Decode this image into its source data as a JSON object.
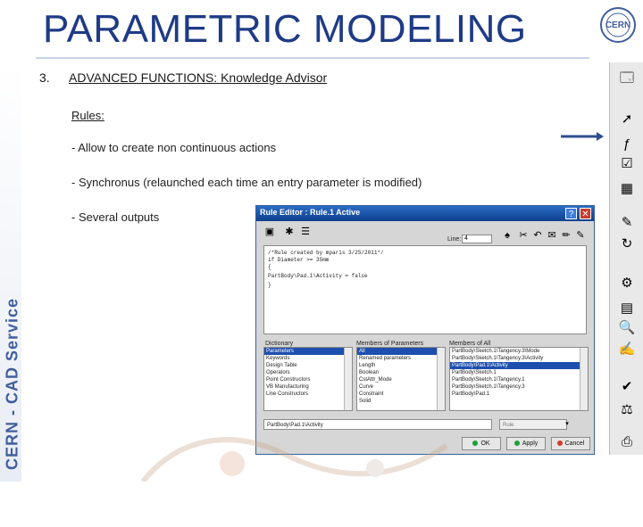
{
  "slide": {
    "title": "PARAMETRIC MODELING",
    "side_label": "CERN - CAD Service",
    "logo_text": "CERN",
    "section_number": "3.",
    "section_title": "ADVANCED FUNCTIONS: Knowledge Advisor",
    "rules_heading": "Rules:",
    "bullets": [
      "- Allow to create non continuous actions",
      "- Synchronus (relaunched each time an entry parameter is modified)",
      "- Several outputs"
    ]
  },
  "dialog": {
    "title": "Rule Editor : Rule.1 Active",
    "help_label": "?",
    "close_label": "✕",
    "line_label": "Line:",
    "line_value": "4",
    "code_lines": [
      "/*Rule created by mparis 3/25/2011*/",
      "if Diameter >= 35mm",
      "{",
      "          PartBody\\Pad.1\\Activity = false",
      "}"
    ],
    "dictionary_header": "Dictionary",
    "dictionary_items": [
      "Parameters",
      "Keywords",
      "Design Table",
      "Operators",
      "Point Constructors",
      "VB Manufacturing",
      "Line Constructors"
    ],
    "members_header": "Members of Parameters",
    "members_items": [
      "All",
      "Renamed parameters",
      "Length",
      "Boolean",
      "CstAttr_Mode",
      "Curve",
      "Constraint",
      "Solid"
    ],
    "all_header": "Members of All",
    "all_items": [
      "PartBody\\Sketch.1\\Tangency.3\\Mode",
      "PartBody\\Sketch.1\\Tangency.3\\Activity",
      "PartBody\\Pad.1\\Activity",
      "PartBody\\Sketch.1",
      "PartBody\\Sketch.1\\Tangency.1",
      "PartBody\\Sketch.1\\Tangency.3",
      "PartBody\\Pad.1"
    ],
    "path_value": "PartBody\\Pad.1\\Activity",
    "combo_value": "Rule",
    "ok_label": "OK",
    "apply_label": "Apply",
    "cancel_label": "Cancel"
  },
  "colors": {
    "title": "#1f3b86",
    "dialog_titlebar": "#1a55ad",
    "arrow": "#2e4e8e",
    "selection": "#1e4fae"
  },
  "toolbar_icons": [
    "catia-logo-icon",
    "select-arrow-icon",
    "formula-icon",
    "checkbox-icon",
    "design-table-icon",
    "rule-icon",
    "reaction-icon",
    "update-icon",
    "measure-icon",
    "search-icon",
    "comment-icon",
    "check-icon",
    "law-icon",
    "report-icon"
  ]
}
